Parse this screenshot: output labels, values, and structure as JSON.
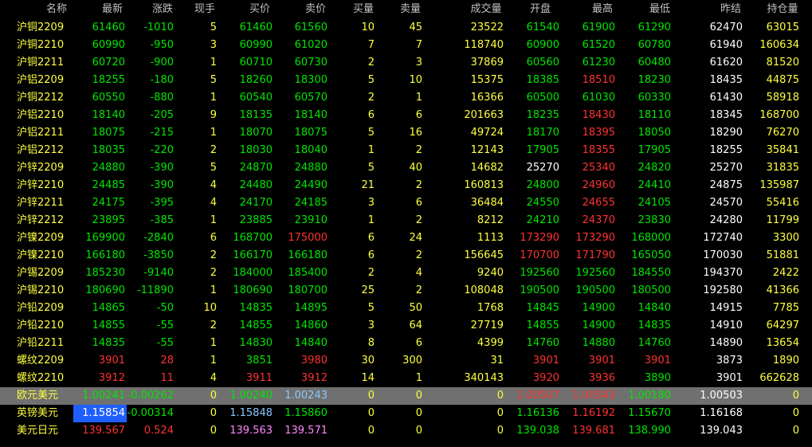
{
  "columns": [
    "名称",
    "最新",
    "涨跌",
    "现手",
    "买价",
    "卖价",
    "买量",
    "卖量",
    "成交量",
    "开盘",
    "最高",
    "最低",
    "昨结",
    "持仓量"
  ],
  "colors": {
    "up": "#ff3232",
    "down": "#00e600",
    "flat": "#ffffff",
    "volume": "#ffff40",
    "name": "#ffff40",
    "header": "#c0c0c0",
    "selected_bg": "#707070",
    "highlight_bg": "#1f5ffe",
    "pale_blue": "#88c8ff"
  },
  "rows": [
    {
      "name": "沪铜2209",
      "vals": [
        "61460",
        "-1010",
        "5",
        "61460",
        "61560",
        "10",
        "45",
        "23522",
        "61540",
        "61900",
        "61290",
        "62470",
        "63015"
      ]
    },
    {
      "name": "沪铜2210",
      "vals": [
        "60990",
        "-950",
        "3",
        "60990",
        "61020",
        "7",
        "7",
        "118740",
        "60900",
        "61520",
        "60780",
        "61940",
        "160634"
      ]
    },
    {
      "name": "沪铜2211",
      "vals": [
        "60720",
        "-900",
        "1",
        "60710",
        "60730",
        "2",
        "3",
        "37869",
        "60560",
        "61230",
        "60480",
        "61620",
        "81520"
      ]
    },
    {
      "name": "沪铝2209",
      "vals": [
        "18255",
        "-180",
        "5",
        "18260",
        "18300",
        "5",
        "10",
        "15375",
        "18385",
        "18510",
        "18230",
        "18435",
        "44875"
      ]
    },
    {
      "name": "沪铜2212",
      "vals": [
        "60550",
        "-880",
        "1",
        "60540",
        "60570",
        "2",
        "1",
        "16366",
        "60500",
        "61030",
        "60330",
        "61430",
        "58918"
      ]
    },
    {
      "name": "沪铝2210",
      "vals": [
        "18140",
        "-205",
        "9",
        "18135",
        "18140",
        "6",
        "6",
        "201663",
        "18235",
        "18430",
        "18110",
        "18345",
        "168700"
      ]
    },
    {
      "name": "沪铝2211",
      "vals": [
        "18075",
        "-215",
        "1",
        "18070",
        "18075",
        "5",
        "16",
        "49724",
        "18170",
        "18395",
        "18050",
        "18290",
        "76270"
      ]
    },
    {
      "name": "沪铝2212",
      "vals": [
        "18035",
        "-220",
        "2",
        "18030",
        "18040",
        "1",
        "2",
        "12143",
        "17905",
        "18355",
        "17905",
        "18255",
        "35841"
      ]
    },
    {
      "name": "沪锌2209",
      "vals": [
        "24880",
        "-390",
        "5",
        "24870",
        "24880",
        "5",
        "40",
        "14682",
        "25270",
        "25340",
        "24820",
        "25270",
        "31835"
      ]
    },
    {
      "name": "沪锌2210",
      "vals": [
        "24485",
        "-390",
        "4",
        "24480",
        "24490",
        "21",
        "2",
        "160813",
        "24800",
        "24960",
        "24410",
        "24875",
        "135987"
      ]
    },
    {
      "name": "沪锌2211",
      "vals": [
        "24175",
        "-395",
        "4",
        "24170",
        "24185",
        "3",
        "6",
        "36484",
        "24550",
        "24655",
        "24105",
        "24570",
        "55416"
      ]
    },
    {
      "name": "沪锌2212",
      "vals": [
        "23895",
        "-385",
        "1",
        "23885",
        "23910",
        "1",
        "2",
        "8212",
        "24210",
        "24370",
        "23830",
        "24280",
        "11799"
      ]
    },
    {
      "name": "沪镍2209",
      "vals": [
        "169900",
        "-2840",
        "6",
        "168700",
        "175000",
        "6",
        "24",
        "1113",
        "173290",
        "173290",
        "168000",
        "172740",
        "3300"
      ]
    },
    {
      "name": "沪镍2210",
      "vals": [
        "166180",
        "-3850",
        "2",
        "166170",
        "166180",
        "6",
        "2",
        "156645",
        "170700",
        "171790",
        "165050",
        "170030",
        "51881"
      ]
    },
    {
      "name": "沪锡2209",
      "vals": [
        "185230",
        "-9140",
        "2",
        "184000",
        "185400",
        "2",
        "4",
        "9240",
        "192560",
        "192560",
        "184550",
        "194370",
        "2422"
      ]
    },
    {
      "name": "沪锡2210",
      "vals": [
        "180690",
        "-11890",
        "1",
        "180690",
        "180700",
        "25",
        "2",
        "108048",
        "190500",
        "190500",
        "180500",
        "192580",
        "41366"
      ]
    },
    {
      "name": "沪铅2209",
      "vals": [
        "14865",
        "-50",
        "10",
        "14835",
        "14895",
        "5",
        "50",
        "1768",
        "14845",
        "14900",
        "14840",
        "14915",
        "7785"
      ]
    },
    {
      "name": "沪铅2210",
      "vals": [
        "14855",
        "-55",
        "2",
        "14855",
        "14860",
        "3",
        "64",
        "27719",
        "14855",
        "14900",
        "14835",
        "14910",
        "64297"
      ]
    },
    {
      "name": "沪铅2211",
      "vals": [
        "14835",
        "-55",
        "1",
        "14830",
        "14840",
        "8",
        "6",
        "4399",
        "14760",
        "14880",
        "14760",
        "14890",
        "13654"
      ]
    },
    {
      "name": "螺纹2209",
      "vals": [
        "3901",
        "28",
        "1",
        "3851",
        "3980",
        "30",
        "300",
        "31",
        "3901",
        "3901",
        "3901",
        "3873",
        "1890"
      ]
    },
    {
      "name": "螺纹2210",
      "vals": [
        "3912",
        "11",
        "4",
        "3911",
        "3912",
        "14",
        "1",
        "340143",
        "3920",
        "3936",
        "3890",
        "3901",
        "662628"
      ]
    },
    {
      "name": "欧元美元",
      "vals": [
        "1.00241",
        "-0.00262",
        "0",
        "1.00240",
        "1.00243",
        "0",
        "0",
        "0",
        "1.00507",
        "1.00543",
        "1.00180",
        "1.00503",
        "0"
      ]
    },
    {
      "name": "英镑美元",
      "vals": [
        "1.15854",
        "-0.00314",
        "0",
        "1.15848",
        "1.15860",
        "0",
        "0",
        "0",
        "1.16136",
        "1.16192",
        "1.15670",
        "1.16168",
        "0"
      ]
    },
    {
      "name": "美元日元",
      "vals": [
        "139.567",
        "0.524",
        "0",
        "139.563",
        "139.571",
        "0",
        "0",
        "0",
        "139.038",
        "139.681",
        "138.990",
        "139.043",
        "0"
      ]
    }
  ]
}
